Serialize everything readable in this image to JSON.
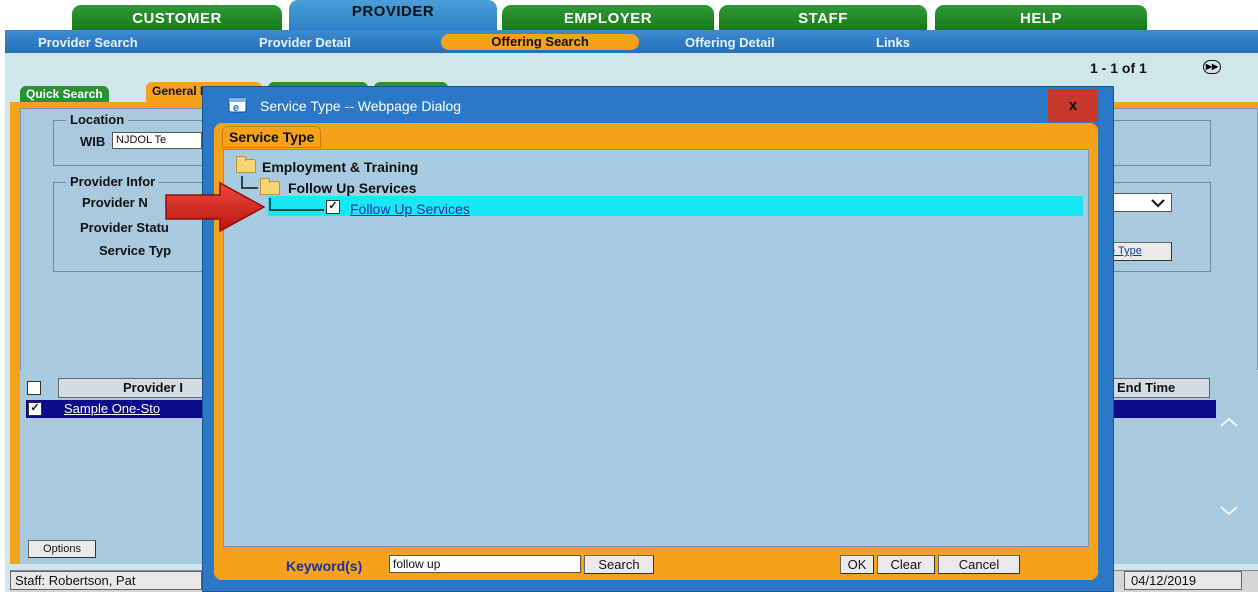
{
  "nav": {
    "tabs": [
      "CUSTOMER",
      "PROVIDER",
      "EMPLOYER",
      "STAFF",
      "HELP"
    ],
    "active_tab": "PROVIDER",
    "subnav": [
      "Provider Search",
      "Provider Detail",
      "Offering Search",
      "Offering Detail",
      "Links"
    ],
    "active_subnav": "Offering Search"
  },
  "pager": {
    "text": "1 - 1 of 1"
  },
  "page_tabs": [
    "Quick Search",
    "General Info"
  ],
  "location": {
    "legend": "Location",
    "wib_label": "WIB",
    "wib_value": "NJDOL Te"
  },
  "provider_info": {
    "legend": "Provider Infor",
    "name_label": "Provider N",
    "status_label": "Provider Statu",
    "service_type_label": "Service Typ",
    "service_type_button": "e Type"
  },
  "grid": {
    "col_provider": "Provider I",
    "col_end_time": "End Time",
    "row_provider": "Sample One-Sto"
  },
  "options_button": "Options",
  "status": {
    "staff": "Staff: Robertson, Pat",
    "date": "04/12/2019"
  },
  "dialog": {
    "title": "Service Type -- Webpage Dialog",
    "close_label": "x",
    "tab_label": "Service Type",
    "tree": {
      "root": "Employment & Training",
      "child": "Follow Up Services",
      "leaf": "Follow Up Services",
      "leaf_checked": true
    },
    "keyword_label": "Keyword(s)",
    "keyword_value": "follow up",
    "search_button": "Search",
    "ok_button": "OK",
    "clear_button": "Clear",
    "cancel_button": "Cancel"
  },
  "colors": {
    "tab_green": "#1e8a26",
    "tab_blue": "#3a8fd0",
    "accent_orange": "#f5a21a",
    "panel_blue": "#a9c9de",
    "highlight_cyan": "#17e8f4",
    "selection_navy": "#0c0c8a",
    "arrow_red": "#d61d1d"
  }
}
